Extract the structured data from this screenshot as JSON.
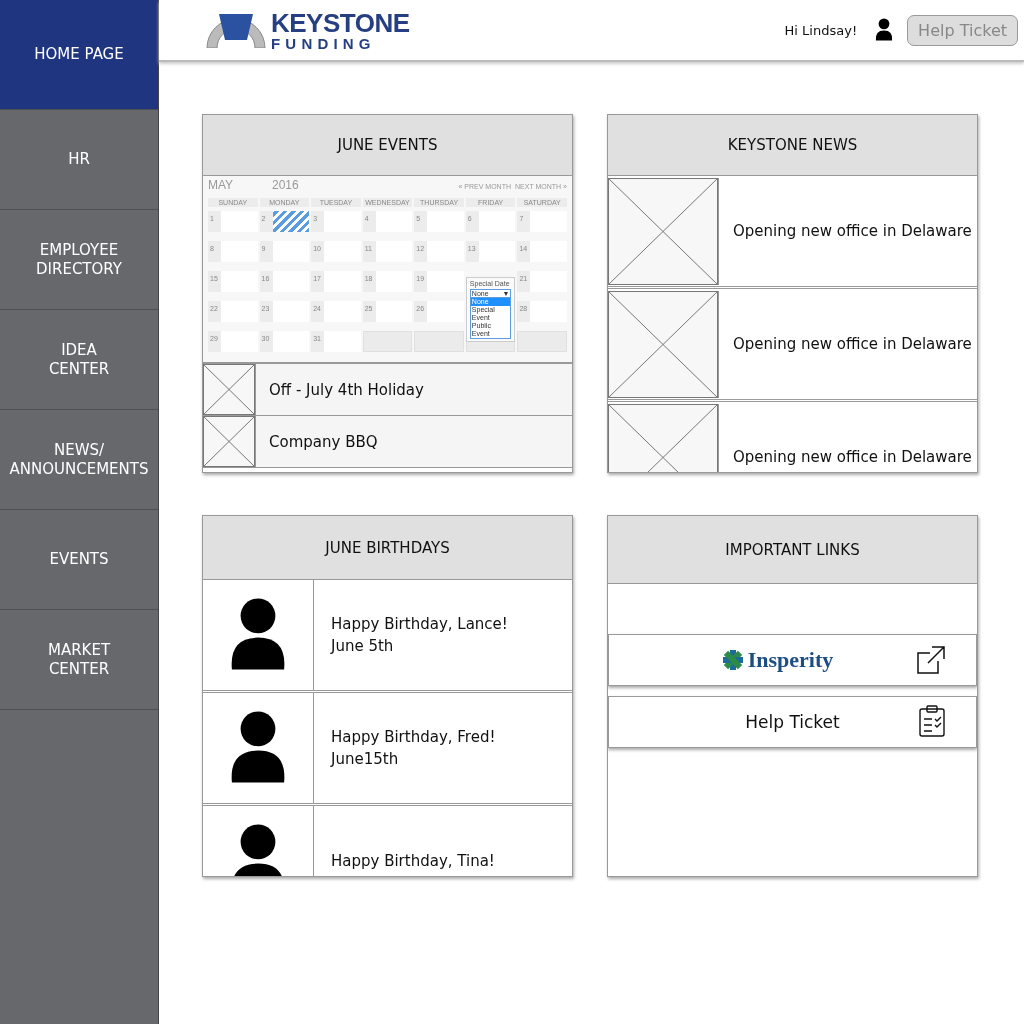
{
  "sidebar": {
    "items": [
      {
        "label": "HOME PAGE",
        "selected": true
      },
      {
        "label": "HR",
        "selected": false
      },
      {
        "label": "EMPLOYEE\nDIRECTORY",
        "selected": false
      },
      {
        "label": "IDEA\nCENTER",
        "selected": false
      },
      {
        "label": "NEWS/\nANNOUNCEMENTS",
        "selected": false
      },
      {
        "label": "EVENTS",
        "selected": false
      },
      {
        "label": "MARKET\nCENTER",
        "selected": false
      }
    ]
  },
  "header": {
    "logo": {
      "line1": "KEYSTONE",
      "line2": "FUNDING"
    },
    "greeting": "Hi Lindsay!",
    "button": "Help Ticket"
  },
  "events": {
    "title": "JUNE EVENTS",
    "calendar": {
      "month": "MAY",
      "year": "2016",
      "prev": "« PREV MONTH",
      "next": "NEXT MONTH »",
      "weekdays": [
        "SUNDAY",
        "MONDAY",
        "TUESDAY",
        "WEDNESDAY",
        "THURSDAY",
        "FRIDAY",
        "SATURDAY"
      ],
      "days": [
        {
          "label": "1",
          "selected": false
        },
        {
          "label": "2",
          "selected": true
        },
        {
          "label": "3",
          "selected": false
        },
        {
          "label": "4",
          "selected": false
        },
        {
          "label": "5",
          "selected": false
        },
        {
          "label": "6",
          "selected": false
        },
        {
          "label": "7",
          "selected": false
        },
        {
          "label": "8",
          "selected": false
        },
        {
          "label": "9",
          "selected": false
        },
        {
          "label": "10",
          "selected": false
        },
        {
          "label": "11",
          "selected": false
        },
        {
          "label": "12",
          "selected": false
        },
        {
          "label": "13",
          "selected": false
        },
        {
          "label": "14",
          "selected": false
        },
        {
          "label": "15",
          "selected": false
        },
        {
          "label": "16",
          "selected": false
        },
        {
          "label": "17",
          "selected": false
        },
        {
          "label": "18",
          "selected": false
        },
        {
          "label": "19",
          "selected": false
        },
        {
          "kind": "covered"
        },
        {
          "label": "21",
          "selected": false
        },
        {
          "label": "22",
          "selected": false
        },
        {
          "label": "23",
          "selected": false
        },
        {
          "label": "24",
          "selected": false
        },
        {
          "label": "25",
          "selected": false
        },
        {
          "label": "26",
          "selected": false
        },
        {
          "kind": "covered"
        },
        {
          "label": "28",
          "selected": false
        },
        {
          "label": "29",
          "selected": false
        },
        {
          "label": "30",
          "selected": false
        },
        {
          "label": "31",
          "selected": false
        }
      ],
      "popup": {
        "label": "Special Date",
        "value": "None",
        "arrow": "▼",
        "options": [
          {
            "label": "None",
            "selected": true
          },
          {
            "label": "Special Event",
            "selected": false
          },
          {
            "label": "Public Event",
            "selected": false
          }
        ]
      }
    },
    "items": [
      {
        "title": "Off - July 4th Holiday"
      },
      {
        "title": "Company BBQ"
      }
    ]
  },
  "news": {
    "title": "KEYSTONE NEWS",
    "items": [
      {
        "text": "Opening new office in Delaware"
      },
      {
        "text": "Opening new office in Delaware"
      },
      {
        "text": "Opening new office in Delaware"
      }
    ]
  },
  "birthdays": {
    "title": "JUNE BIRTHDAYS",
    "items": [
      {
        "lines": [
          "Happy Birthday, Lance!",
          "June 5th"
        ]
      },
      {
        "lines": [
          "Happy Birthday, Fred!",
          "June15th"
        ]
      },
      {
        "lines": [
          "Happy Birthday, Tina!"
        ]
      }
    ]
  },
  "links": {
    "title": "IMPORTANT LINKS",
    "items": [
      {
        "kind": "logo",
        "label": "Insperity"
      },
      {
        "kind": "text",
        "label": "Help Ticket"
      }
    ]
  }
}
